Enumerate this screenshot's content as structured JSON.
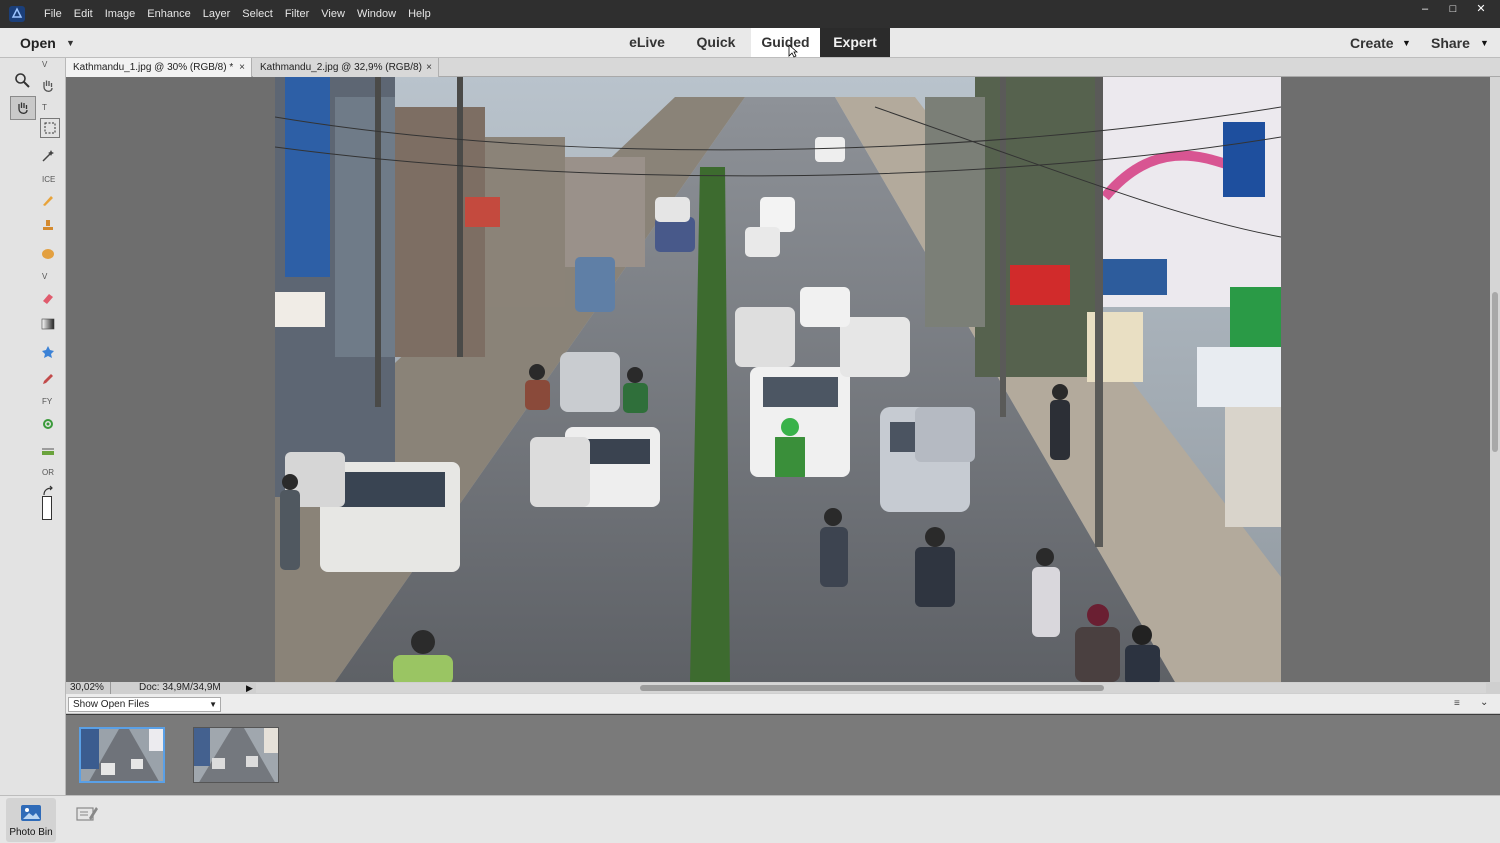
{
  "menubar": {
    "items": [
      "File",
      "Edit",
      "Image",
      "Enhance",
      "Layer",
      "Select",
      "Filter",
      "View",
      "Window",
      "Help"
    ],
    "window_controls": [
      "–",
      "□",
      "✕"
    ]
  },
  "modebar": {
    "open_label": "Open",
    "tabs": [
      {
        "label": "eLive"
      },
      {
        "label": "Quick"
      },
      {
        "label": "Guided"
      },
      {
        "label": "Expert"
      }
    ],
    "create_label": "Create",
    "share_label": "Share"
  },
  "toolbar": {
    "sections": [
      "V",
      "T",
      "ICE",
      "V",
      "FY",
      "OR"
    ]
  },
  "documents": [
    {
      "title": "Kathmandu_1.jpg @ 30% (RGB/8) *"
    },
    {
      "title": "Kathmandu_2.jpg @ 32,9% (RGB/8)"
    }
  ],
  "status": {
    "zoom": "30,02%",
    "doc_size": "Doc: 34,9M/34,9M"
  },
  "photo_bin": {
    "filter_value": "Show Open Files",
    "label": "Photo Bin"
  },
  "colors": {
    "accent": "#5aa0e6",
    "expert_tab_bg": "#2b2b2b",
    "canvas_bg": "#6e6e6e"
  }
}
